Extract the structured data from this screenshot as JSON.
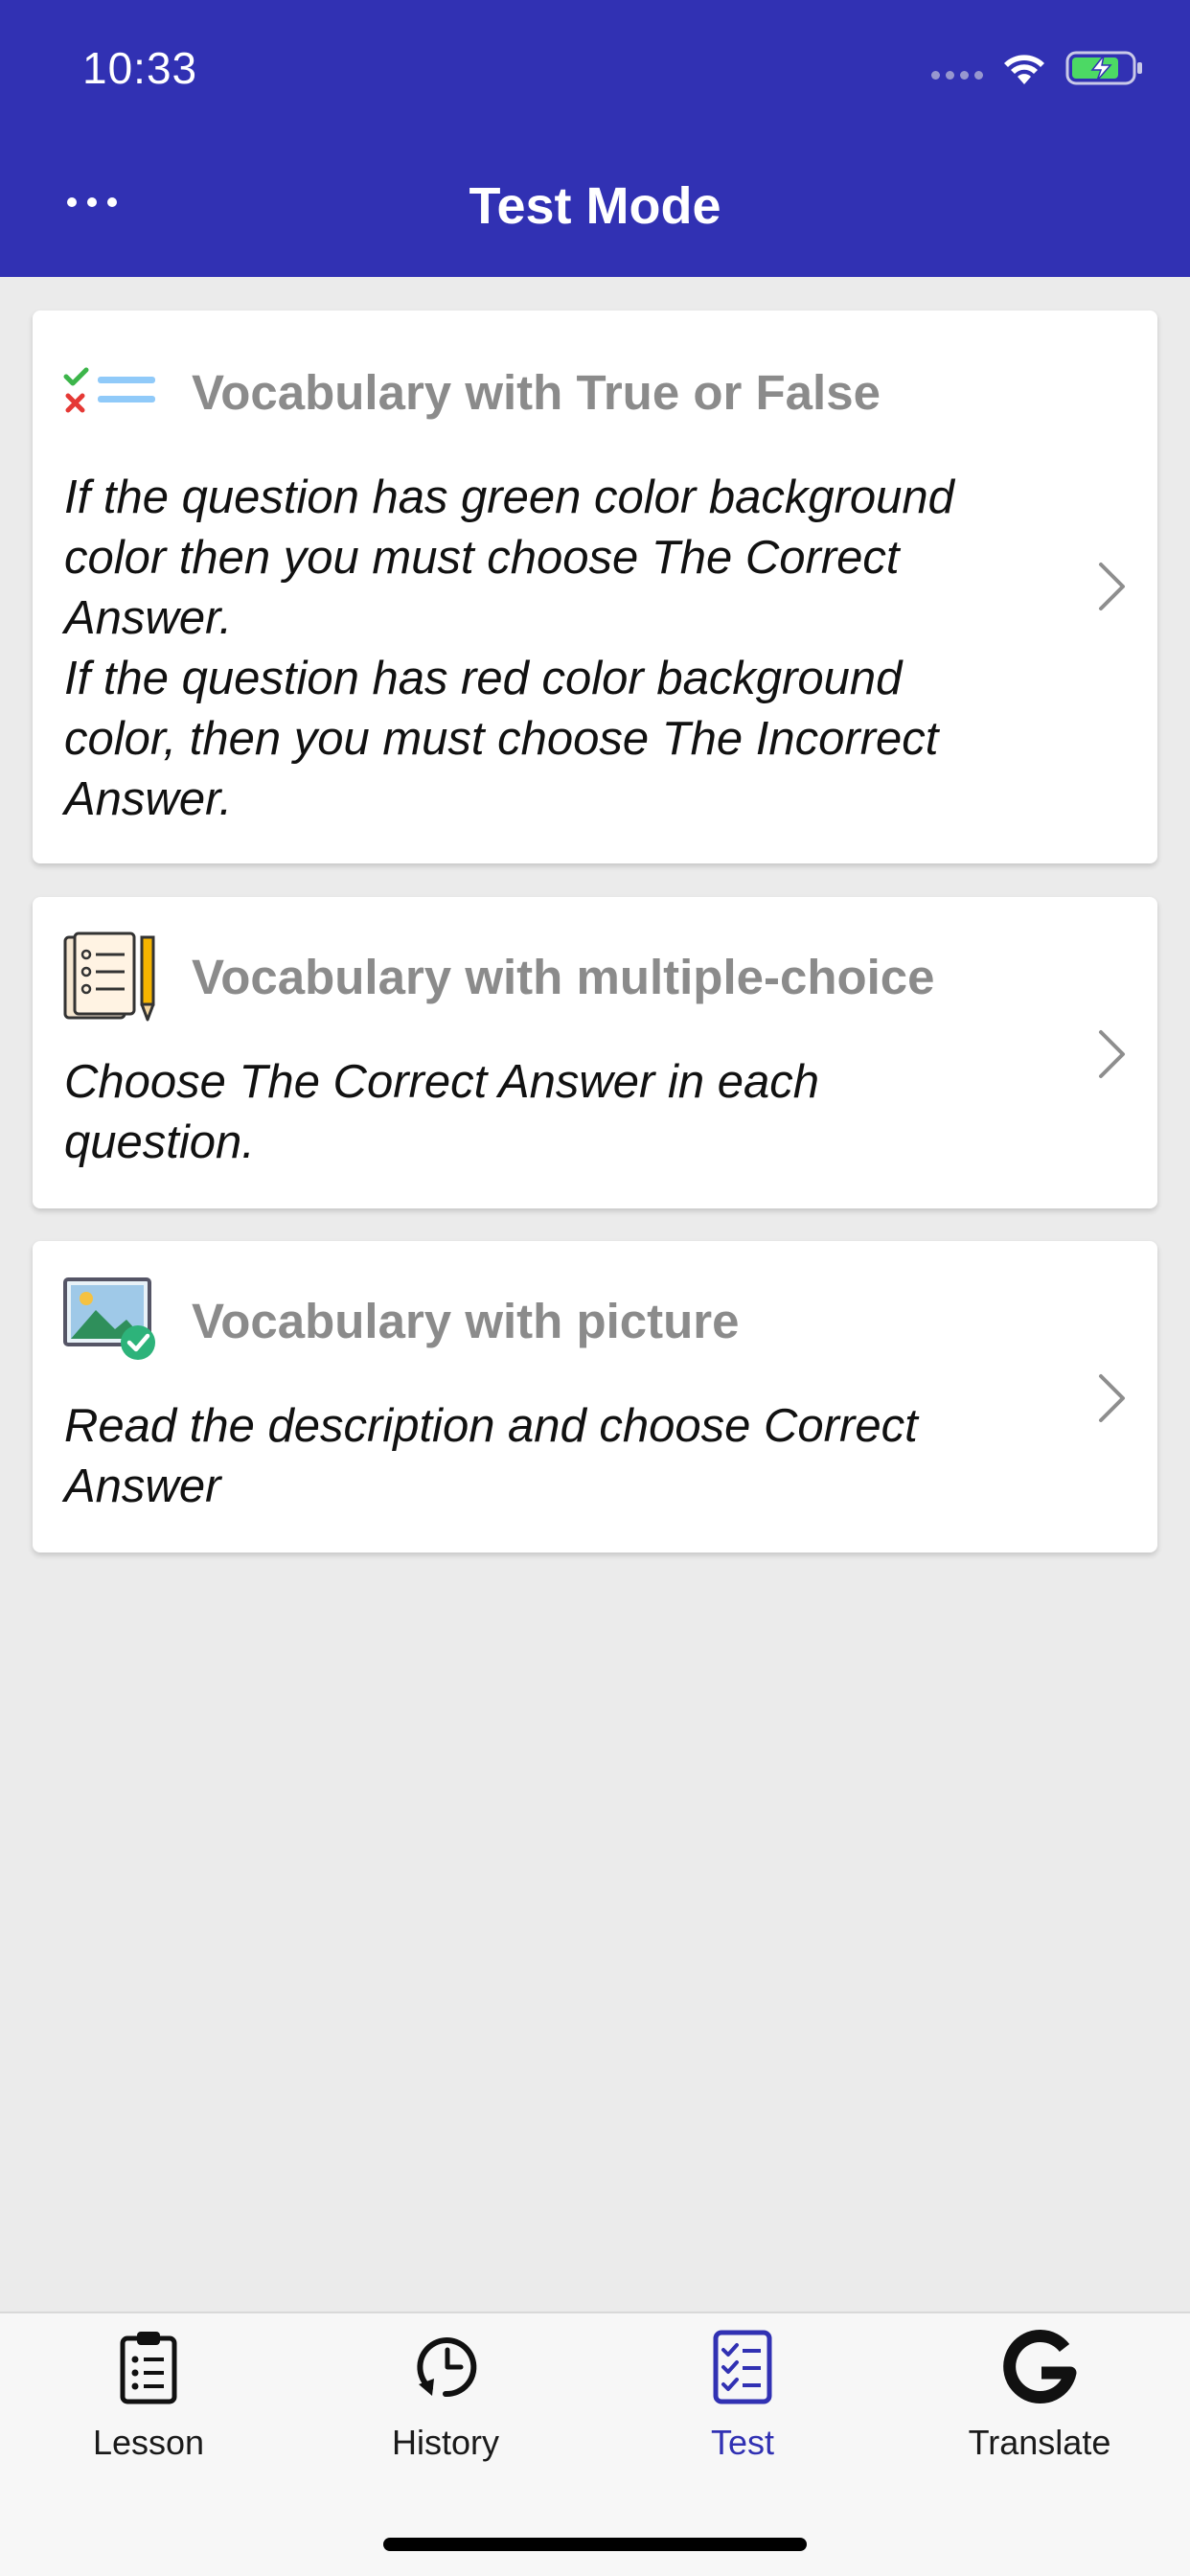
{
  "status_bar": {
    "time": "10:33"
  },
  "nav": {
    "title": "Test Mode",
    "menu_icon": "more-dots-icon"
  },
  "colors": {
    "header": "#3131b3",
    "accent": "#3131b3",
    "background": "#ebebeb",
    "card_title": "#8b8b8b"
  },
  "cards": [
    {
      "title": "Vocabulary with True or False",
      "icon": "true-false-list-icon",
      "description": [
        "If the question has green color background",
        "color then you must choose The Correct",
        "Answer.",
        "If the question has red color background",
        "color, then you must choose The Incorrect",
        "Answer."
      ]
    },
    {
      "title": "Vocabulary with multiple-choice",
      "icon": "checklist-pencil-icon",
      "description": [
        "Choose The Correct Answer in each",
        "question."
      ]
    },
    {
      "title": "Vocabulary with picture",
      "icon": "picture-check-icon",
      "description": [
        "Read the description and choose Correct",
        "Answer"
      ]
    }
  ],
  "tabs": [
    {
      "label": "Lesson",
      "icon": "clipboard-list-icon",
      "active": false
    },
    {
      "label": "History",
      "icon": "history-clock-icon",
      "active": false
    },
    {
      "label": "Test",
      "icon": "test-checklist-icon",
      "active": true
    },
    {
      "label": "Translate",
      "icon": "google-g-icon",
      "active": false
    }
  ]
}
